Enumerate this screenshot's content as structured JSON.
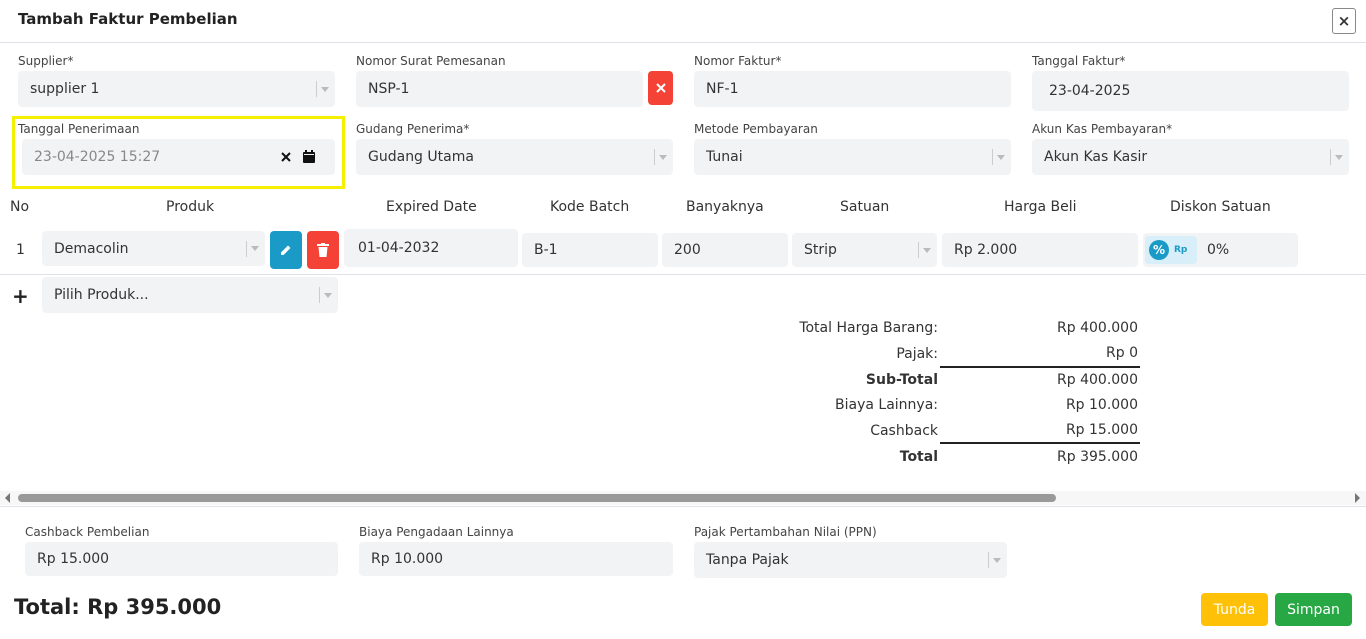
{
  "modal": {
    "title": "Tambah Faktur Pembelian",
    "close_symbol": "×"
  },
  "header_fields": {
    "supplier": {
      "label": "Supplier*",
      "value": "supplier 1"
    },
    "nomor_surat_pemesanan": {
      "label": "Nomor Surat Pemesanan",
      "value": "NSP-1"
    },
    "nomor_faktur": {
      "label": "Nomor Faktur*",
      "value": "NF-1"
    },
    "tanggal_faktur": {
      "label": "Tanggal Faktur*",
      "value": "23-04-2025"
    },
    "tanggal_penerimaan": {
      "label": "Tanggal Penerimaan",
      "value": "23-04-2025 15:27"
    },
    "gudang_penerima": {
      "label": "Gudang Penerima*",
      "value": "Gudang Utama"
    },
    "metode_pembayaran": {
      "label": "Metode Pembayaran",
      "value": "Tunai"
    },
    "akun_kas_pembayaran": {
      "label": "Akun Kas Pembayaran*",
      "value": "Akun Kas Kasir"
    }
  },
  "table": {
    "columns": [
      "No",
      "Produk",
      "Expired Date",
      "Kode Batch",
      "Banyaknya",
      "Satuan",
      "Harga Beli",
      "Diskon Satuan"
    ],
    "rows": [
      {
        "no": "1",
        "produk": "Demacolin",
        "expired_date": "01-04-2032",
        "kode_batch": "B-1",
        "banyaknya": "200",
        "satuan": "Strip",
        "harga_beli": "Rp 2.000",
        "diskon_satuan": "0%",
        "diskon_percent_symbol": "%",
        "diskon_rp_symbol": "Rp"
      }
    ],
    "add_row": {
      "plus": "+",
      "placeholder": "Pilih Produk..."
    }
  },
  "summary": {
    "total_harga_barang": {
      "label": "Total Harga Barang:",
      "value": "Rp 400.000"
    },
    "pajak": {
      "label": "Pajak:",
      "value": "Rp 0"
    },
    "sub_total": {
      "label": "Sub-Total",
      "value": "Rp 400.000"
    },
    "biaya_lainnya": {
      "label": "Biaya Lainnya:",
      "value": "Rp 10.000"
    },
    "cashback": {
      "label": "Cashback",
      "value": "Rp 15.000"
    },
    "total": {
      "label": "Total",
      "value": "Rp 395.000"
    }
  },
  "footer_fields": {
    "cashback_pembelian": {
      "label": "Cashback Pembelian",
      "value": "Rp 15.000"
    },
    "biaya_pengadaan_lainnya": {
      "label": "Biaya Pengadaan Lainnya",
      "value": "Rp 10.000"
    },
    "ppn": {
      "label": "Pajak Pertambahan Nilai (PPN)",
      "value": "Tanpa Pajak"
    }
  },
  "footer": {
    "total_text": "Total: Rp 395.000",
    "tunda_label": "Tunda",
    "simpan_label": "Simpan"
  },
  "colors": {
    "highlight": "#f5ef00",
    "danger": "#f44336",
    "info": "#1a9bc7",
    "warning": "#fec107",
    "success": "#28a745"
  }
}
